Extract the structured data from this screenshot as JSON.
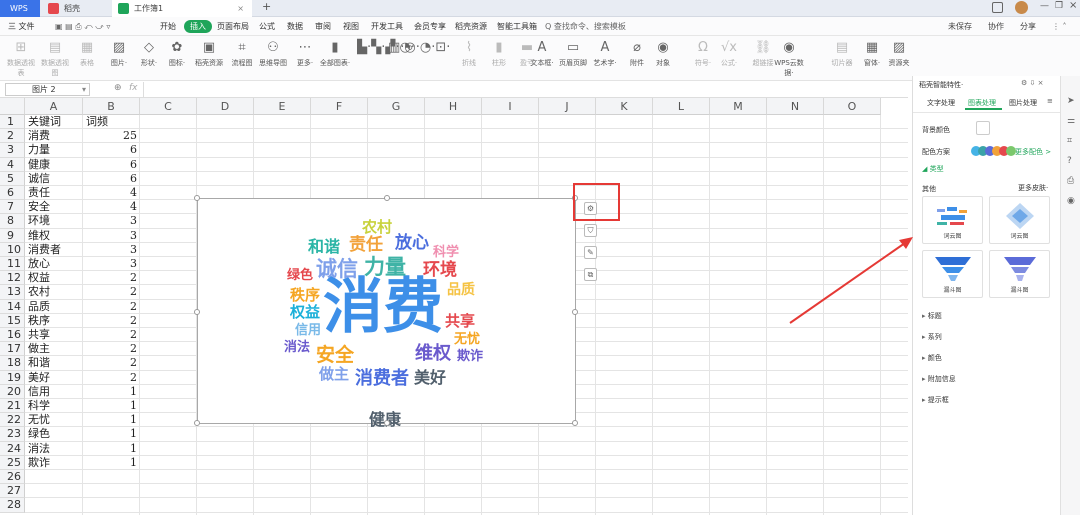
{
  "tabs": {
    "wps": "WPS",
    "daoke": "稻壳",
    "book": "工作簿1",
    "close": "×",
    "add": "+"
  },
  "menu": {
    "file": "三 文件",
    "items": [
      "开始",
      "插入",
      "页面布局",
      "公式",
      "数据",
      "审阅",
      "视图",
      "开发工具",
      "会员专享",
      "稻壳资源",
      "智能工具箱"
    ],
    "search": "Q 查找命令、搜索模板",
    "right": [
      "未保存",
      "协作",
      "分享"
    ]
  },
  "ribbon": [
    {
      "label": "数据透视表",
      "icon": "⊞",
      "dim": true
    },
    {
      "label": "数据透视图",
      "icon": "▤",
      "dim": true
    },
    {
      "label": "表格",
      "icon": "▦",
      "dim": true
    },
    {
      "label": "图片·",
      "icon": "▨"
    },
    {
      "label": "形状·",
      "icon": "◇"
    },
    {
      "label": "图标·",
      "icon": "✿"
    },
    {
      "label": "稻壳资源",
      "icon": "▣"
    },
    {
      "label": "流程图",
      "icon": "⌗"
    },
    {
      "label": "思维导图",
      "icon": "⚇"
    },
    {
      "label": "更多·",
      "icon": "⋯"
    },
    {
      "label": "全部图表·",
      "icon": "▮"
    },
    {
      "label": "",
      "icon": "▙·▚·▞·◔·"
    },
    {
      "label": "",
      "icon": "▥·◎·◔·⊡·"
    },
    {
      "label": "折线",
      "icon": "⌇",
      "dim": true
    },
    {
      "label": "柱形",
      "icon": "▮",
      "dim": true
    },
    {
      "label": "盈亏",
      "icon": "▬",
      "dim": true
    },
    {
      "label": "文本框·",
      "icon": "A"
    },
    {
      "label": "页眉页脚",
      "icon": "▭"
    },
    {
      "label": "艺术字·",
      "icon": "A"
    },
    {
      "label": "附件",
      "icon": "⌀"
    },
    {
      "label": "对象",
      "icon": "◉"
    },
    {
      "label": "符号·",
      "icon": "Ω",
      "dim": true
    },
    {
      "label": "公式·",
      "icon": "√x",
      "dim": true
    },
    {
      "label": "超链接",
      "icon": "⛓",
      "dim": true
    },
    {
      "label": "WPS云数据·",
      "icon": "◉"
    },
    {
      "label": "切片器",
      "icon": "▤",
      "dim": true
    },
    {
      "label": "窗体·",
      "icon": "▦"
    },
    {
      "label": "资源夹",
      "icon": "▨"
    }
  ],
  "formula_bar": {
    "name": "图片 2",
    "fx": "fx"
  },
  "columns": [
    "A",
    "B",
    "C",
    "D",
    "E",
    "F",
    "G",
    "H",
    "I",
    "J",
    "K",
    "L",
    "M",
    "N",
    "O"
  ],
  "rows": [
    [
      "关键词",
      "词频"
    ],
    [
      "消费",
      "25"
    ],
    [
      "力量",
      "6"
    ],
    [
      "健康",
      "6"
    ],
    [
      "诚信",
      "6"
    ],
    [
      "责任",
      "4"
    ],
    [
      "安全",
      "4"
    ],
    [
      "环境",
      "3"
    ],
    [
      "维权",
      "3"
    ],
    [
      "消费者",
      "3"
    ],
    [
      "放心",
      "3"
    ],
    [
      "权益",
      "2"
    ],
    [
      "农村",
      "2"
    ],
    [
      "品质",
      "2"
    ],
    [
      "秩序",
      "2"
    ],
    [
      "共享",
      "2"
    ],
    [
      "做主",
      "2"
    ],
    [
      "和谐",
      "2"
    ],
    [
      "美好",
      "2"
    ],
    [
      "信用",
      "1"
    ],
    [
      "科学",
      "1"
    ],
    [
      "无忧",
      "1"
    ],
    [
      "绿色",
      "1"
    ],
    [
      "消法",
      "1"
    ],
    [
      "欺诈",
      "1"
    ],
    [
      "",
      ""
    ],
    [
      "",
      ""
    ],
    [
      "",
      ""
    ]
  ],
  "wordcloud": [
    {
      "t": "消费",
      "c": "#3d8fe8"
    },
    {
      "t": "诚信",
      "c": "#7fa0ea"
    },
    {
      "t": "力量",
      "c": "#3fb3a6"
    },
    {
      "t": "健康",
      "c": "#52606d"
    },
    {
      "t": "责任",
      "c": "#f2a23a"
    },
    {
      "t": "放心",
      "c": "#4b6ede"
    },
    {
      "t": "环境",
      "c": "#e5484d"
    },
    {
      "t": "和谐",
      "c": "#2bb5a6"
    },
    {
      "t": "农村",
      "c": "#c8d23c"
    },
    {
      "t": "科学",
      "c": "#f08fb0"
    },
    {
      "t": "绿色",
      "c": "#e5484d"
    },
    {
      "t": "秩序",
      "c": "#f5a623"
    },
    {
      "t": "权益",
      "c": "#1bb0d9"
    },
    {
      "t": "信用",
      "c": "#79b9e8"
    },
    {
      "t": "品质",
      "c": "#f5c344"
    },
    {
      "t": "共享",
      "c": "#e5484d"
    },
    {
      "t": "无忧",
      "c": "#f5a623"
    },
    {
      "t": "消法",
      "c": "#6a5acd"
    },
    {
      "t": "安全",
      "c": "#f5a623"
    },
    {
      "t": "维权",
      "c": "#6a5acd"
    },
    {
      "t": "欺诈",
      "c": "#6a5acd"
    },
    {
      "t": "做主",
      "c": "#7fa0ea"
    },
    {
      "t": "消费者",
      "c": "#4b6ede"
    },
    {
      "t": "美好",
      "c": "#52606d"
    }
  ],
  "panel": {
    "title": "稻壳智能特性·",
    "tabs": [
      "文字处理",
      "图表处理",
      "图片处理"
    ],
    "bg_label": "背景颜色",
    "scheme_label": "配色方案",
    "more_colors": "更多配色 >",
    "type_label": "◢ 类型",
    "other_label": "其他",
    "more_skin": "更多皮肤·",
    "thumbs": [
      "词云图",
      "词云图",
      "漏斗图",
      "漏斗图"
    ],
    "sections": [
      "标题",
      "系列",
      "颜色",
      "附加信息",
      "提示框"
    ],
    "swatches": [
      "#45b3e6",
      "#3aa3a8",
      "#5b6bd8",
      "#f2a23a",
      "#e5484d",
      "#7bc86c"
    ],
    "accent": "#1fa55a"
  }
}
